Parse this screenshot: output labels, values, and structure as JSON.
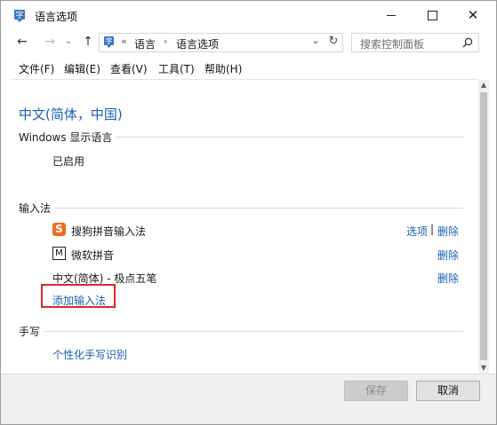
{
  "window": {
    "title": "语言选项"
  },
  "titlebar": {
    "minimize": "—",
    "maximize": "□",
    "close": "✕"
  },
  "nav": {
    "back_icon": "←",
    "forward_icon": "→",
    "recent_icon": "⌄",
    "up_icon": "↑",
    "address": {
      "overflow": "«",
      "crumbs": [
        "语言",
        "语言选项"
      ],
      "separator": "›",
      "dropdown_icon": "⌄",
      "refresh_icon": "↻"
    },
    "search": {
      "placeholder": "搜索控制面板"
    }
  },
  "menu": {
    "items": [
      "文件(F)",
      "编辑(E)",
      "查看(V)",
      "工具(T)",
      "帮助(H)"
    ]
  },
  "content": {
    "language_title": "中文(简体，中国)",
    "display_language": {
      "label": "Windows 显示语言",
      "status": "已启用"
    },
    "input_methods": {
      "label": "输入法",
      "items": [
        {
          "name": "搜狗拼音输入法",
          "icon": "sogou-icon",
          "icon_glyph": "S",
          "options": "选项",
          "separator": "|",
          "remove": "删除"
        },
        {
          "name": "微软拼音",
          "icon": "microsoft-pinyin-icon",
          "icon_glyph": "M",
          "remove": "删除"
        },
        {
          "name": "中文(简体) - 极点五笔",
          "remove": "删除"
        }
      ],
      "add_link": "添加输入法"
    },
    "handwriting": {
      "label": "手写",
      "link": "个性化手写识别"
    }
  },
  "scrollbar": {
    "up_icon": "▲",
    "down_icon": "▼"
  },
  "buttons": {
    "save": "保存",
    "cancel": "取消"
  },
  "colors": {
    "link": "#1a5fb4",
    "highlight": "#d9292a",
    "sogou": "#f26c1e"
  }
}
